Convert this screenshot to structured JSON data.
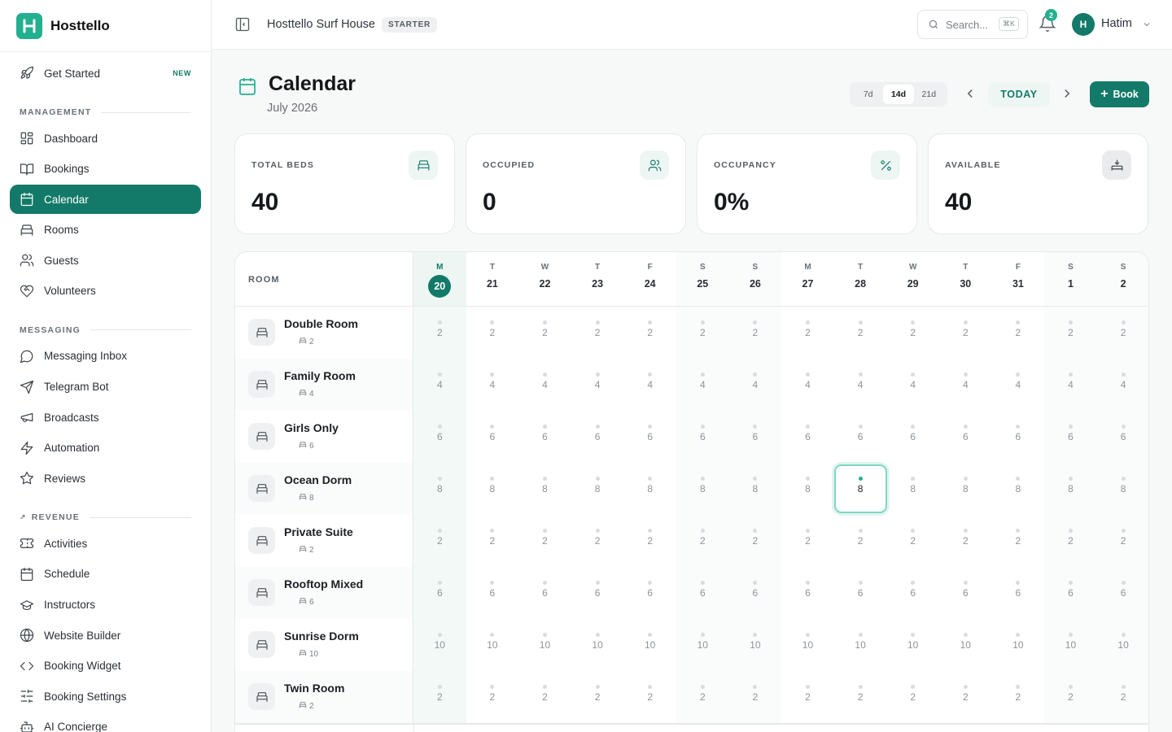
{
  "brand": {
    "name": "Hosttello"
  },
  "sidebar": {
    "get_started": {
      "label": "Get Started",
      "badge": "NEW"
    },
    "sections": {
      "management": "MANAGEMENT",
      "messaging": "MESSAGING",
      "revenue": "REVENUE"
    },
    "items": {
      "dashboard": "Dashboard",
      "bookings": "Bookings",
      "calendar": "Calendar",
      "rooms": "Rooms",
      "guests": "Guests",
      "volunteers": "Volunteers",
      "messaging_inbox": "Messaging Inbox",
      "telegram_bot": "Telegram Bot",
      "broadcasts": "Broadcasts",
      "automation": "Automation",
      "reviews": "Reviews",
      "activities": "Activities",
      "schedule": "Schedule",
      "instructors": "Instructors",
      "website_builder": "Website Builder",
      "booking_widget": "Booking Widget",
      "booking_settings": "Booking Settings",
      "ai_concierge": "AI Concierge"
    }
  },
  "topbar": {
    "property": "Hosttello Surf House",
    "plan": "STARTER",
    "search_placeholder": "Search...",
    "search_shortcut": "⌘K",
    "notifications": "2",
    "user_initial": "H",
    "user_name": "Hatim"
  },
  "page": {
    "title": "Calendar",
    "subtitle": "July 2026",
    "ranges": [
      "7d",
      "14d",
      "21d"
    ],
    "selected_range": "14d",
    "today_label": "TODAY",
    "book_label": "Book"
  },
  "stats": {
    "total_beds": {
      "label": "TOTAL BEDS",
      "value": "40"
    },
    "occupied": {
      "label": "OCCUPIED",
      "value": "0"
    },
    "occupancy": {
      "label": "OCCUPANCY",
      "value": "0%"
    },
    "available": {
      "label": "AVAILABLE",
      "value": "40"
    }
  },
  "calendar": {
    "room_header": "ROOM",
    "current_index": 0,
    "selected_cell": {
      "row": 3,
      "col": 8
    },
    "days": [
      {
        "dow": "M",
        "num": "20"
      },
      {
        "dow": "T",
        "num": "21"
      },
      {
        "dow": "W",
        "num": "22"
      },
      {
        "dow": "T",
        "num": "23"
      },
      {
        "dow": "F",
        "num": "24"
      },
      {
        "dow": "S",
        "num": "25"
      },
      {
        "dow": "S",
        "num": "26"
      },
      {
        "dow": "M",
        "num": "27"
      },
      {
        "dow": "T",
        "num": "28"
      },
      {
        "dow": "W",
        "num": "29"
      },
      {
        "dow": "T",
        "num": "30"
      },
      {
        "dow": "F",
        "num": "31"
      },
      {
        "dow": "S",
        "num": "1"
      },
      {
        "dow": "S",
        "num": "2"
      }
    ],
    "rooms": [
      {
        "name": "Double Room",
        "beds": "2",
        "avail": "2"
      },
      {
        "name": "Family Room",
        "beds": "4",
        "avail": "4"
      },
      {
        "name": "Girls Only",
        "beds": "6",
        "avail": "6"
      },
      {
        "name": "Ocean Dorm",
        "beds": "8",
        "avail": "8"
      },
      {
        "name": "Private Suite",
        "beds": "2",
        "avail": "2"
      },
      {
        "name": "Rooftop Mixed",
        "beds": "6",
        "avail": "6"
      },
      {
        "name": "Sunrise Dorm",
        "beds": "10",
        "avail": "10"
      },
      {
        "name": "Twin Room",
        "beds": "2",
        "avail": "2"
      }
    ]
  },
  "colors": {
    "accent": "#137a69",
    "accent_light": "#23b08f"
  }
}
